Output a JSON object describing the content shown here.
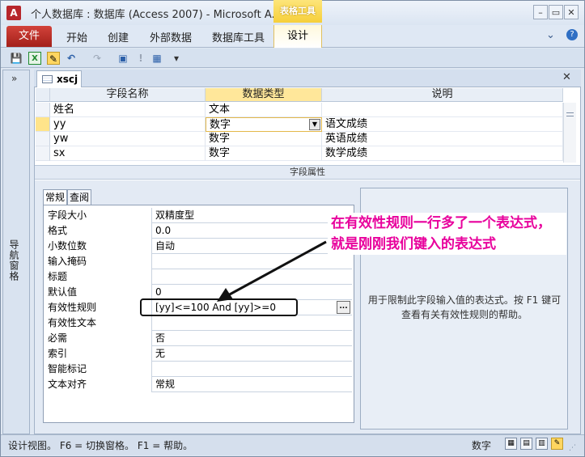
{
  "window": {
    "app_icon": "A",
    "title": "个人数据库 : 数据库 (Access 2007) - Microsoft A...",
    "context_tools": "表格工具",
    "controls": {
      "minimize": "–",
      "restore": "▭",
      "close": "✕"
    }
  },
  "ribbon": {
    "file_tab": "文件",
    "tabs": [
      "开始",
      "创建",
      "外部数据",
      "数据库工具"
    ],
    "design_tab": "设计",
    "help_icon": "?",
    "collapse_icon": "⌄"
  },
  "quick_access": [
    {
      "icon": "save-icon",
      "glyph": "💾"
    },
    {
      "icon": "excel-icon",
      "glyph": "X"
    },
    {
      "icon": "design-view-icon",
      "glyph": "✎"
    },
    {
      "icon": "undo-icon",
      "glyph": "↶"
    },
    {
      "icon": "redo-icon",
      "glyph": "↷"
    },
    {
      "icon": "view-icon",
      "glyph": "▣"
    },
    {
      "icon": "primary-key-icon",
      "glyph": "!"
    },
    {
      "icon": "table-icon",
      "glyph": "▦"
    },
    {
      "icon": "customize-icon",
      "glyph": "▾"
    }
  ],
  "nav": {
    "toggle": "»",
    "label": "导航窗格"
  },
  "document": {
    "tab_label": "xscj",
    "close": "✕",
    "columns": [
      "字段名称",
      "数据类型",
      "说明"
    ],
    "rows": [
      {
        "name": "姓名",
        "type": "文本",
        "desc": ""
      },
      {
        "name": "yy",
        "type": "数字",
        "desc": "语文成绩"
      },
      {
        "name": "yw",
        "type": "数字",
        "desc": "英语成绩"
      },
      {
        "name": "sx",
        "type": "数字",
        "desc": "数学成绩"
      }
    ]
  },
  "field_properties": {
    "title": "字段属性",
    "tabs": [
      "常规",
      "查阅"
    ],
    "properties": [
      {
        "label": "字段大小",
        "value": "双精度型"
      },
      {
        "label": "格式",
        "value": "0.0"
      },
      {
        "label": "小数位数",
        "value": "自动"
      },
      {
        "label": "输入掩码",
        "value": ""
      },
      {
        "label": "标题",
        "value": ""
      },
      {
        "label": "默认值",
        "value": "0"
      },
      {
        "label": "有效性规则",
        "value": "[yy]<=100 And [yy]>=0"
      },
      {
        "label": "有效性文本",
        "value": ""
      },
      {
        "label": "必需",
        "value": "否"
      },
      {
        "label": "索引",
        "value": "无"
      },
      {
        "label": "智能标记",
        "value": ""
      },
      {
        "label": "文本对齐",
        "value": "常规"
      }
    ],
    "builder_button": "...",
    "help_text": "用于限制此字段输入值的表达式。按 F1 键可查看有关有效性规则的帮助。"
  },
  "annotation": {
    "text": "在有效性规则一行多了一个表达式，就是刚刚我们键入的表达式",
    "color": "#e8009c"
  },
  "status_bar": {
    "left": "设计视图。   F6 = 切换窗格。   F1 = 帮助。",
    "mode": "数字"
  }
}
